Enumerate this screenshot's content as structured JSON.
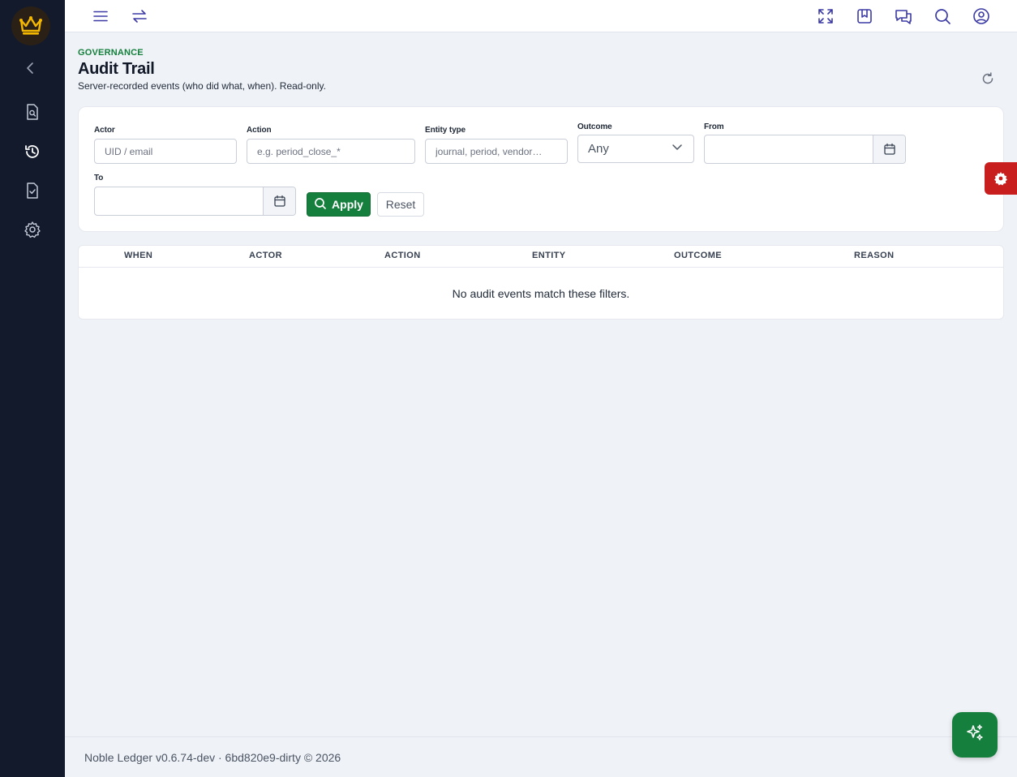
{
  "app": {
    "footer": "Noble Ledger v0.6.74-dev · 6bd820e9-dirty © 2026"
  },
  "colors": {
    "sidebar": "#131a2c",
    "accent": "#15803d",
    "danger": "#c81e1e",
    "icon_top": "#3b3aa5",
    "crown": "#f5b800"
  },
  "sidebar": {
    "items": [
      {
        "icon": "chevron-left-icon"
      },
      {
        "icon": "document-search-icon"
      },
      {
        "icon": "history-icon",
        "active": true
      },
      {
        "icon": "document-check-icon"
      },
      {
        "icon": "gear-icon"
      }
    ]
  },
  "topbar": {
    "icons": [
      "menu-icon",
      "swap-icon",
      "fullscreen-icon",
      "bookmark-icon",
      "chat-icon",
      "search-icon",
      "user-icon"
    ]
  },
  "header": {
    "eyebrow": "GOVERNANCE",
    "title": "Audit Trail",
    "subtitle": "Server-recorded events (who did what, when). Read-only."
  },
  "filters": {
    "actor": {
      "label": "Actor",
      "placeholder": "UID / email",
      "value": ""
    },
    "action": {
      "label": "Action",
      "placeholder": "e.g. period_close_*",
      "value": ""
    },
    "entity_type": {
      "label": "Entity type",
      "placeholder": "journal, period, vendor…",
      "value": ""
    },
    "outcome": {
      "label": "Outcome",
      "value": "Any"
    },
    "from": {
      "label": "From",
      "value": ""
    },
    "to": {
      "label": "To",
      "value": ""
    },
    "apply_label": "Apply",
    "reset_label": "Reset"
  },
  "table": {
    "columns": [
      "WHEN",
      "ACTOR",
      "ACTION",
      "ENTITY",
      "OUTCOME",
      "REASON"
    ],
    "rows": [],
    "empty_message": "No audit events match these filters."
  }
}
